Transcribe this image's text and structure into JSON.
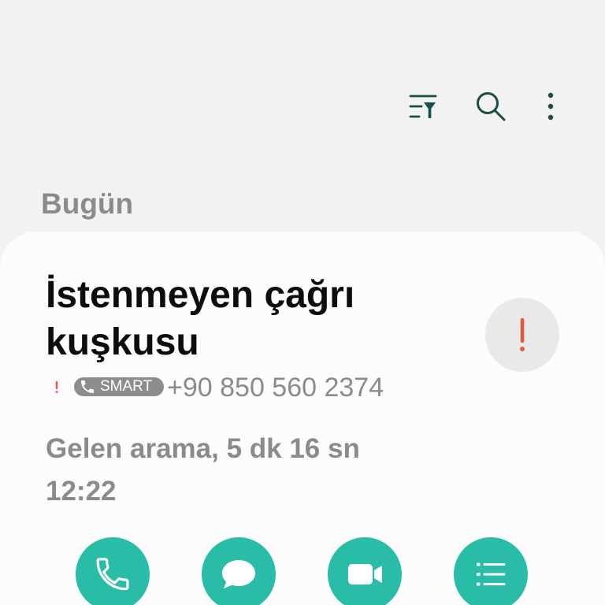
{
  "colors": {
    "background": "#f2f2f2",
    "card": "#fcfcfc",
    "icon": "#1b4d47",
    "accent": "#29bda7",
    "primary_text": "#0d0d0d",
    "secondary_text": "#8b8b8b",
    "alert": "#e25c3c",
    "avatar": "#e9e9e9",
    "badge": "#8d8d8d"
  },
  "toolbar": {
    "icons": [
      "filter-icon",
      "search-icon",
      "more-options-icon"
    ]
  },
  "call_log": {
    "section_header": "Bugün",
    "entries": [
      {
        "name": "İstenmeyen çağrı kuşkusu",
        "status_icon": "exclamation-icon",
        "badge": {
          "icon": "phone-icon",
          "label": "SMART"
        },
        "number": "+90 850 560 2374",
        "details": "Gelen arama, 5 dk 16 sn",
        "time": "12:22",
        "avatar_icon": "exclamation-icon",
        "actions": [
          {
            "icon": "phone-icon"
          },
          {
            "icon": "message-icon"
          },
          {
            "icon": "video-camera-icon"
          },
          {
            "icon": "list-icon"
          }
        ]
      }
    ]
  }
}
